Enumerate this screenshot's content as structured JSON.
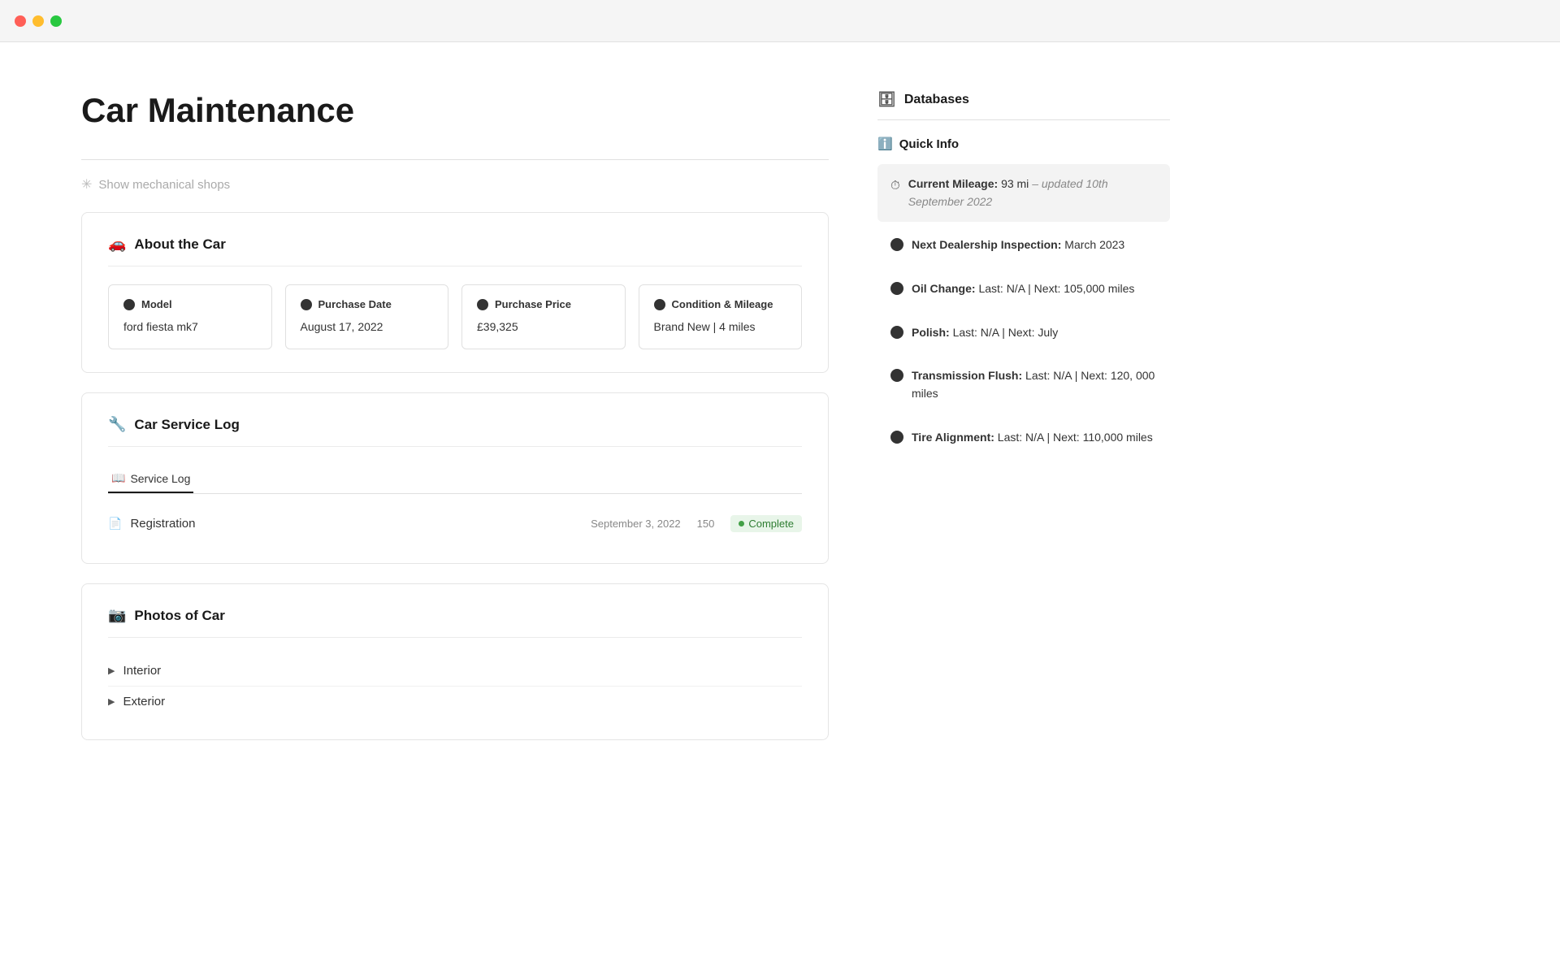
{
  "titlebar": {
    "close_btn": "close",
    "min_btn": "minimize",
    "max_btn": "maximize"
  },
  "page": {
    "title": "Car Maintenance"
  },
  "show_shops": {
    "label": "Show mechanical shops"
  },
  "about_car": {
    "section_title": "About the Car",
    "cards": [
      {
        "label": "Model",
        "value": "ford fiesta mk7"
      },
      {
        "label": "Purchase Date",
        "value": "August 17, 2022"
      },
      {
        "label": "Purchase Price",
        "value": "£39,325"
      },
      {
        "label": "Condition & Mileage",
        "value": "Brand New | 4 miles"
      }
    ]
  },
  "service_log": {
    "section_title": "Car Service Log",
    "tab_label": "Service Log",
    "rows": [
      {
        "name": "Registration",
        "date": "September 3, 2022",
        "number": "150",
        "status": "Complete"
      }
    ]
  },
  "photos": {
    "section_title": "Photos of Car",
    "items": [
      {
        "label": "Interior"
      },
      {
        "label": "Exterior"
      }
    ]
  },
  "sidebar": {
    "databases_label": "Databases",
    "quick_info_label": "Quick Info",
    "items": [
      {
        "type": "speed",
        "text_before": "Current Mileage: ",
        "value": "93 mi",
        "text_after": " – updated 10th September 2022",
        "highlighted": true
      },
      {
        "type": "radio",
        "text_before": "Next Dealership Inspection: ",
        "value": "March 2023",
        "highlighted": false
      },
      {
        "type": "radio",
        "text_before": "Oil Change: ",
        "value": "Last: N/A | Next: 105,000 miles",
        "highlighted": false
      },
      {
        "type": "radio",
        "text_before": "Polish: ",
        "value": "Last: N/A | Next: July",
        "highlighted": false
      },
      {
        "type": "radio",
        "text_before": "Transmission Flush: ",
        "value": "Last: N/A | Next: 120, 000 miles",
        "highlighted": false
      },
      {
        "type": "radio",
        "text_before": "Tire Alignment: ",
        "value": "Last: N/A | Next: 110,000 miles",
        "highlighted": false
      }
    ]
  }
}
